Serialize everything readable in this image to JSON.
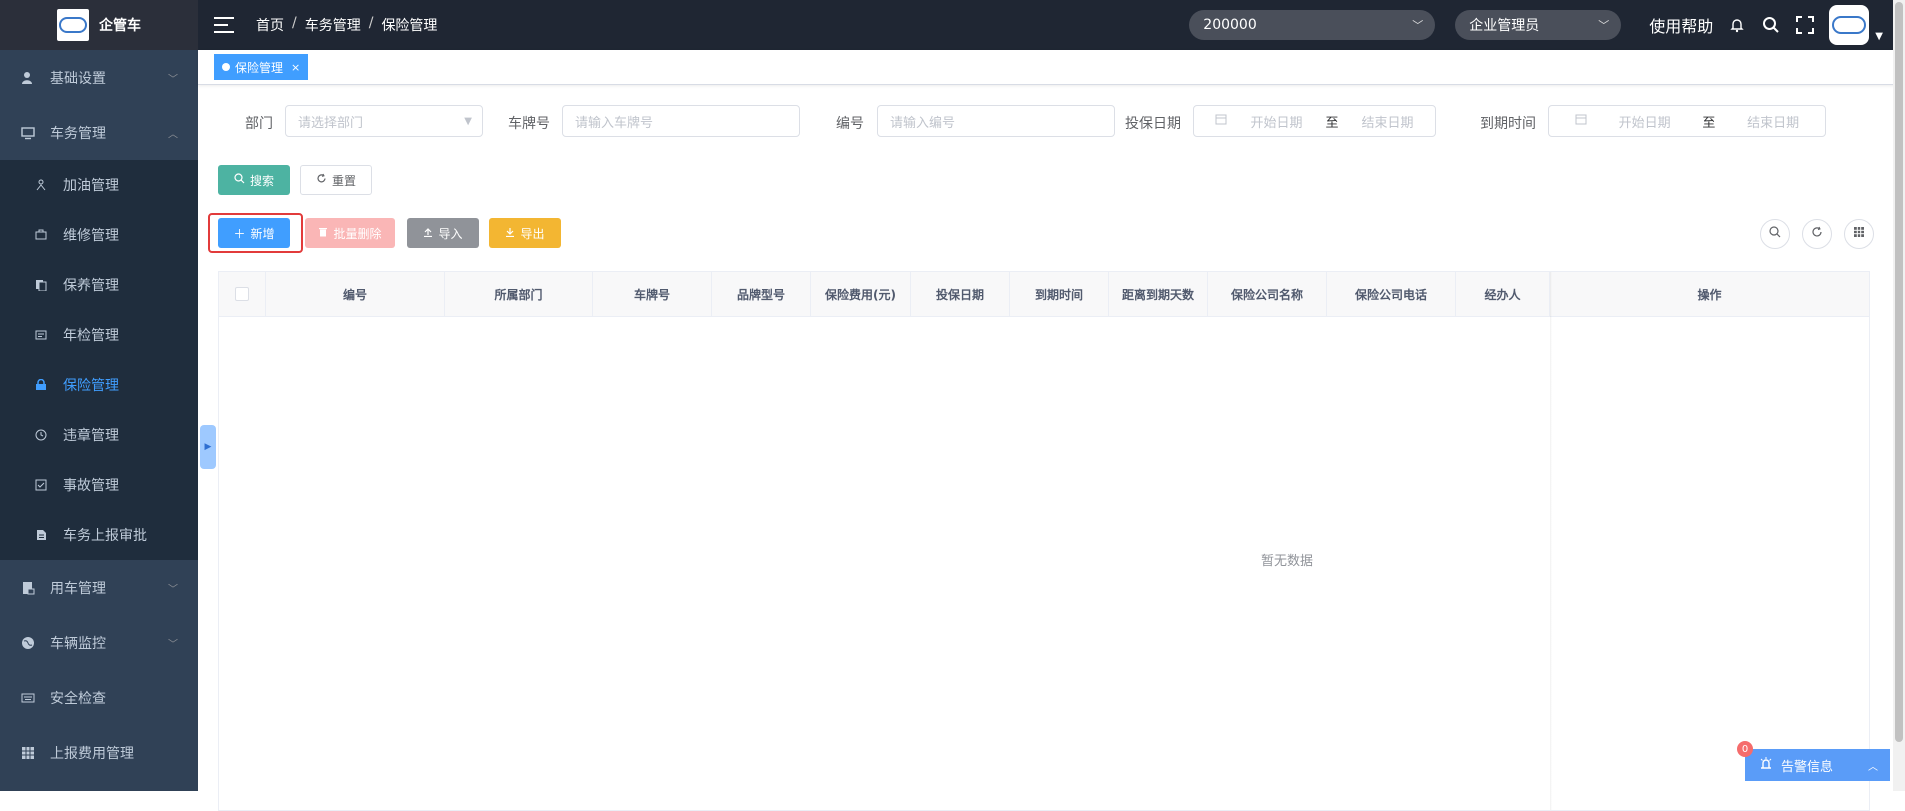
{
  "app": {
    "title": "企管车"
  },
  "sidebar": {
    "items": [
      {
        "label": "基础设置"
      },
      {
        "label": "车务管理"
      },
      {
        "label": "用车管理"
      },
      {
        "label": "车辆监控"
      },
      {
        "label": "安全检查"
      },
      {
        "label": "上报费用管理"
      }
    ],
    "subitems": [
      {
        "label": "加油管理"
      },
      {
        "label": "维修管理"
      },
      {
        "label": "保养管理"
      },
      {
        "label": "年检管理"
      },
      {
        "label": "保险管理"
      },
      {
        "label": "违章管理"
      },
      {
        "label": "事故管理"
      },
      {
        "label": "车务上报审批"
      }
    ]
  },
  "header": {
    "breadcrumb": [
      "首页",
      "车务管理",
      "保险管理"
    ],
    "company_select": "200000",
    "role_select": "企业管理员",
    "help": "使用帮助"
  },
  "tags": {
    "active": "保险管理",
    "close": "×"
  },
  "filters": {
    "dept_label": "部门",
    "dept_placeholder": "请选择部门",
    "plate_label": "车牌号",
    "plate_placeholder": "请输入车牌号",
    "code_label": "编号",
    "code_placeholder": "请输入编号",
    "insure_date_label": "投保日期",
    "expire_label": "到期时间",
    "start_placeholder": "开始日期",
    "to": "至",
    "end_placeholder": "结束日期"
  },
  "buttons": {
    "search": "搜索",
    "reset": "重置",
    "add": "新增",
    "batch_delete": "批量删除",
    "import": "导入",
    "export": "导出"
  },
  "table": {
    "headers": [
      "编号",
      "所属部门",
      "车牌号",
      "品牌型号",
      "保险费用(元)",
      "投保日期",
      "到期时间",
      "距离到期天数",
      "保险公司名称",
      "保险公司电话",
      "经办人",
      "操作"
    ],
    "empty": "暂无数据"
  },
  "alarm": {
    "label": "告警信息",
    "count": "0"
  },
  "colors": {
    "primary": "#409eff",
    "sidebar": "#304156",
    "topbar": "#1f2633",
    "search": "#4db3a2",
    "danger": "#fab6b6",
    "warning": "#f3b632"
  }
}
